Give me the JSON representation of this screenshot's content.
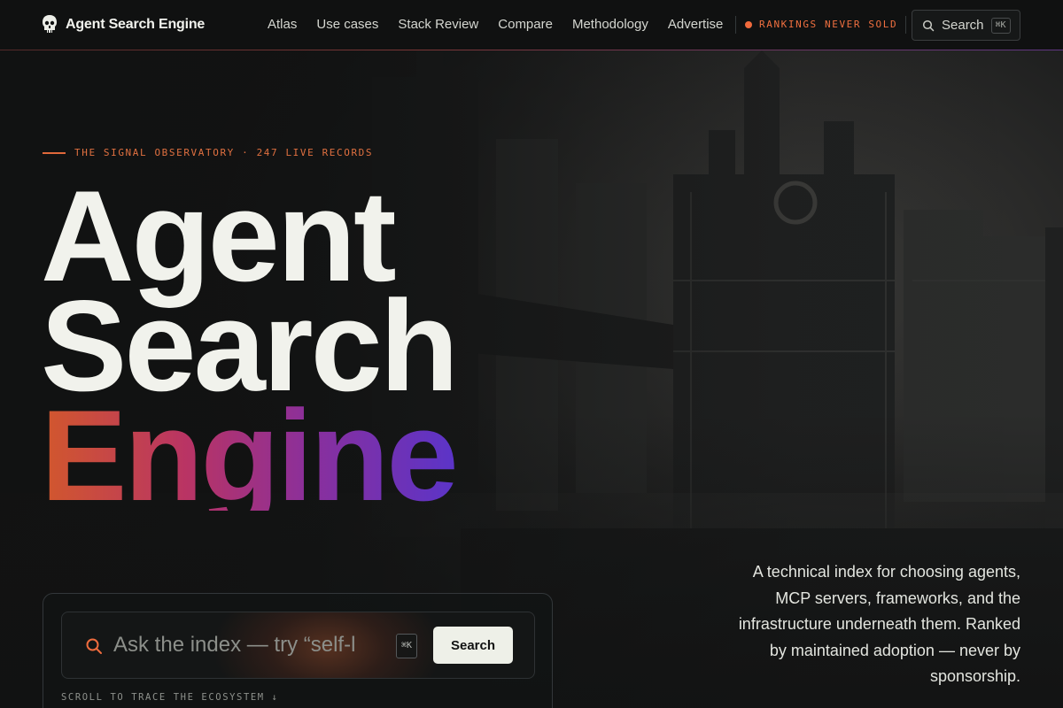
{
  "brand": {
    "name": "Agent Search Engine",
    "logo_icon": "skull-logo-icon"
  },
  "nav": {
    "links": [
      "Atlas",
      "Use cases",
      "Stack Review",
      "Compare",
      "Methodology",
      "Advertise"
    ],
    "badge": "RANKINGS NEVER SOLD",
    "search_label": "Search",
    "search_shortcut": "⌘K"
  },
  "hero": {
    "eyebrow": "THE SIGNAL OBSERVATORY · 247 LIVE RECORDS",
    "title_line1": "Agent",
    "title_line2": "Search",
    "title_line3": "Engine",
    "blurb": "A technical index for choosing agents, MCP servers, frameworks, and the infrastructure underneath them. Ranked by maintained adoption — never by sponsorship."
  },
  "search_panel": {
    "placeholder": "Ask the index — try “self-l",
    "shortcut": "⌘K",
    "button": "Search",
    "scroll_hint": "SCROLL TO TRACE THE ECOSYSTEM ↓"
  },
  "colors": {
    "accent_orange": "#f06a3c",
    "gradient_start": "#d2582c",
    "gradient_mid": "#b93464",
    "gradient_end": "#5b34c8",
    "background": "#111212"
  }
}
